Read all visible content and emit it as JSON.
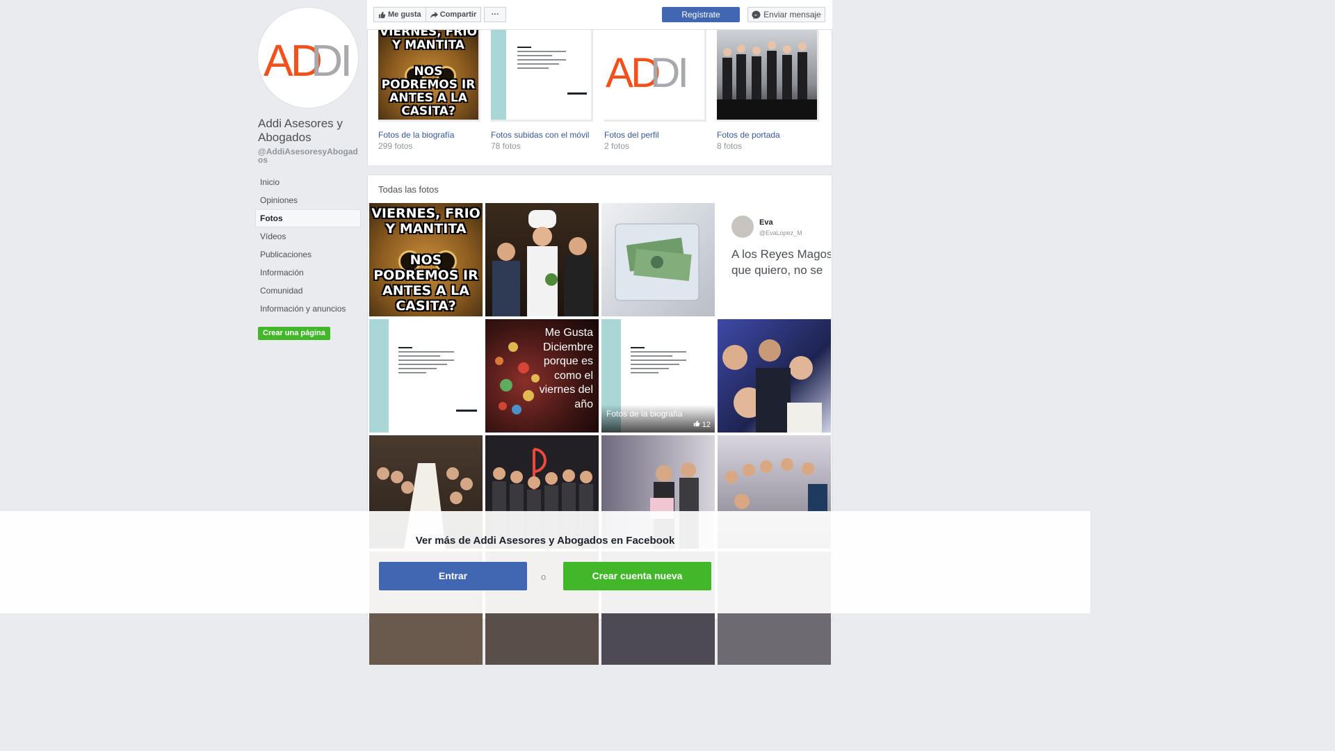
{
  "sidebar": {
    "page_name": "Addi Asesores y Abogados",
    "page_handle": "@AddiAsesoresyAbogados",
    "nav_items": [
      "Inicio",
      "Opiniones",
      "Fotos",
      "Vídeos",
      "Publicaciones",
      "Información",
      "Comunidad",
      "Información y anuncios"
    ],
    "active_item": "Fotos",
    "create_page_label": "Crear una página",
    "logo_text": "ADDI"
  },
  "topbar": {
    "like_label": "Me gusta",
    "share_label": "Compartir",
    "more_label": "···",
    "register_label": "Regístrate",
    "message_label": "Enviar mensaje"
  },
  "albums": [
    {
      "title": "Fotos de la biografía",
      "count": "299 fotos"
    },
    {
      "title": "Fotos subidas con el móvil",
      "count": "78 fotos"
    },
    {
      "title": "Fotos del perfil",
      "count": "2 fotos"
    },
    {
      "title": "Fotos de portada",
      "count": "8 fotos"
    }
  ],
  "all_photos": {
    "title": "Todas las fotos",
    "meme_top": "VIERNES, FRIO Y MANTITA",
    "meme_bottom": "NOS PODREMOS IR ANTES A LA CASITA?",
    "tweet_name": "Eva",
    "tweet_handle": "@EvaLopez_M",
    "tweet_text": "A los Reyes Magos que quiero, no se",
    "december_text": "Me Gusta Diciembre porque es como el viernes del año",
    "hover_caption": "Fotos de la biografía",
    "hover_likes": "12"
  },
  "overlay": {
    "title": "Ver más de Addi Asesores y Abogados en Facebook",
    "login_label": "Entrar",
    "or_label": "o",
    "signup_label": "Crear cuenta nueva"
  },
  "colors": {
    "facebook_blue": "#4267b2",
    "link_blue": "#365899",
    "green": "#42b72a",
    "logo_orange": "#f2501c",
    "logo_gray": "#a7a9ac"
  }
}
